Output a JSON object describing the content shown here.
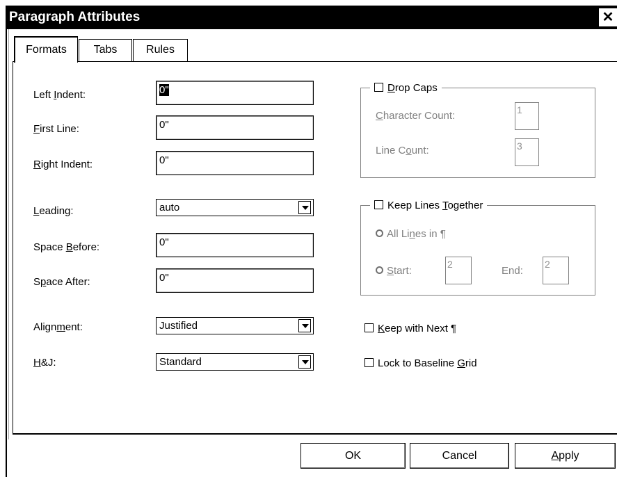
{
  "window": {
    "title": "Paragraph Attributes",
    "close_glyph": "✕"
  },
  "tabs": [
    {
      "label": "Formats",
      "active": true
    },
    {
      "label": "Tabs",
      "active": false
    },
    {
      "label": "Rules",
      "active": false
    }
  ],
  "formats": {
    "left_indent": {
      "label_pre": "Left ",
      "label_u": "I",
      "label_post": "ndent:",
      "value": "0\""
    },
    "first_line": {
      "label_pre": "",
      "label_u": "F",
      "label_post": "irst Line:",
      "value": "0\""
    },
    "right_indent": {
      "label_pre": "",
      "label_u": "R",
      "label_post": "ight Indent:",
      "value": "0\""
    },
    "leading": {
      "label_pre": "",
      "label_u": "L",
      "label_post": "eading:",
      "value": "auto"
    },
    "space_before": {
      "label_pre": "Space ",
      "label_u": "B",
      "label_post": "efore:",
      "value": "0\""
    },
    "space_after": {
      "label_pre": "S",
      "label_u": "p",
      "label_post": "ace After:",
      "value": "0\""
    },
    "alignment": {
      "label_pre": "Align",
      "label_u": "m",
      "label_post": "ent:",
      "value": "Justified"
    },
    "hj": {
      "label_pre": "",
      "label_u": "H",
      "label_post": "&J:",
      "value": "Standard"
    }
  },
  "drop_caps": {
    "label_pre": "",
    "label_u": "D",
    "label_post": "rop Caps",
    "checked": false,
    "char_count": {
      "label_pre": "",
      "label_u": "C",
      "label_post": "haracter Count:",
      "value": "1"
    },
    "line_count": {
      "label_pre": "Line C",
      "label_u": "o",
      "label_post": "unt:",
      "value": "3"
    }
  },
  "keep_lines": {
    "label_pre": "Keep Lines ",
    "label_u": "T",
    "label_post": "ogether",
    "checked": false,
    "all_lines": {
      "label_pre": "All Li",
      "label_u": "n",
      "label_post": "es in ¶"
    },
    "start": {
      "label_pre": "",
      "label_u": "S",
      "label_post": "tart:",
      "value": "2"
    },
    "end": {
      "label": "End:",
      "value": "2"
    }
  },
  "keep_next": {
    "label_pre": "",
    "label_u": "K",
    "label_post": "eep with Next ¶",
    "checked": false
  },
  "lock_baseline": {
    "label_pre": "Lock to Baseline ",
    "label_u": "G",
    "label_post": "rid",
    "checked": false
  },
  "buttons": {
    "ok": "OK",
    "cancel": "Cancel",
    "apply": {
      "label_pre": "",
      "label_u": "A",
      "label_post": "pply"
    }
  }
}
